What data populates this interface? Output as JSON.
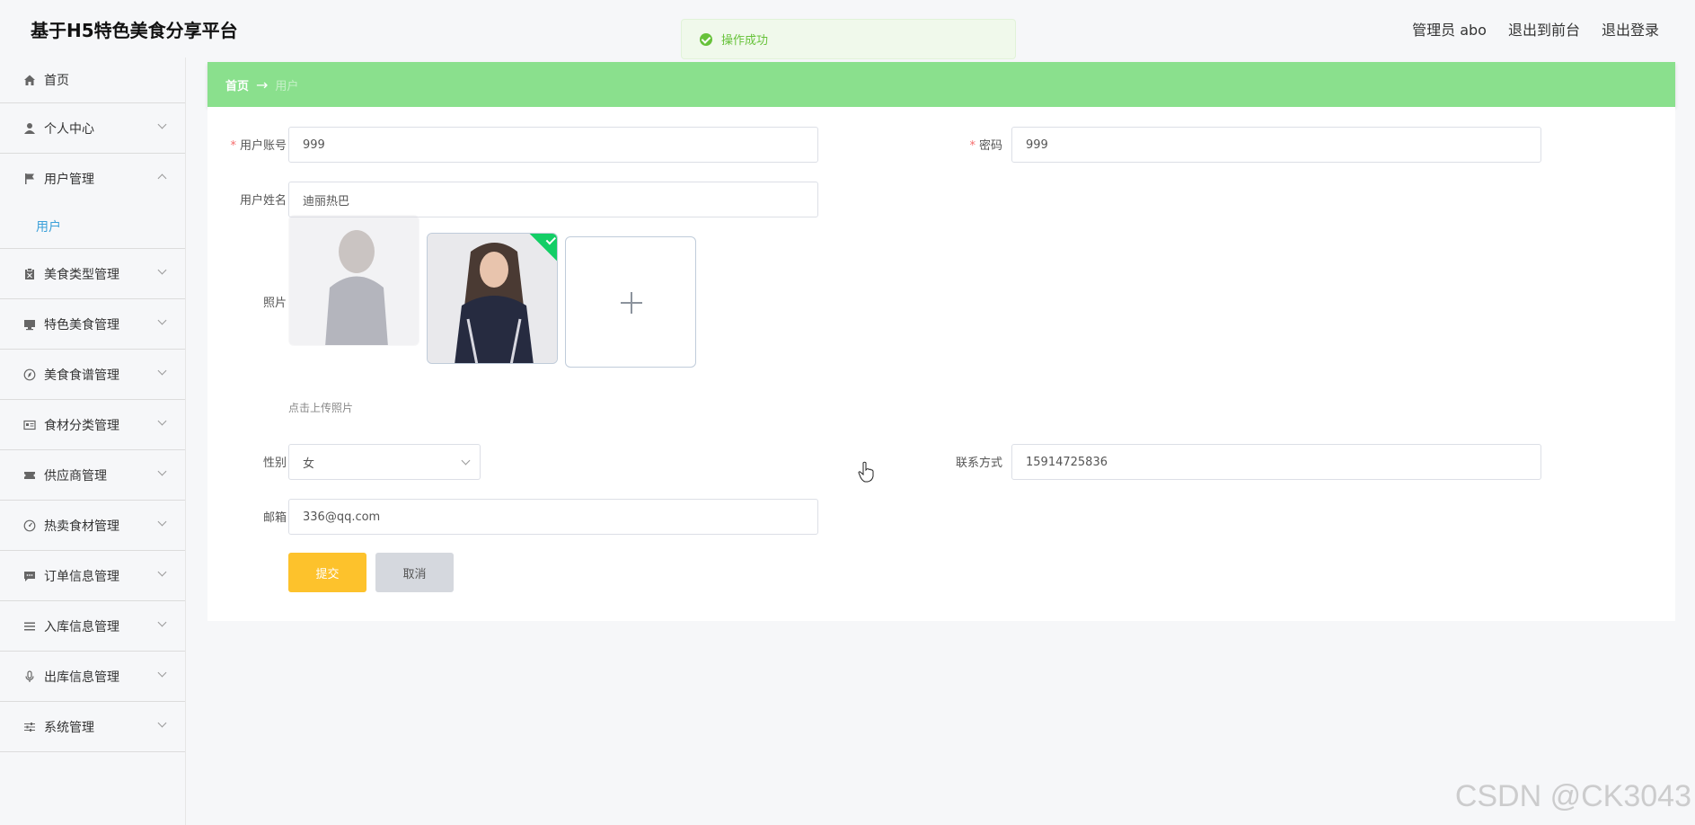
{
  "header": {
    "title": "基于H5特色美食分享平台",
    "user": "管理员 abo",
    "to_front": "退出到前台",
    "logout": "退出登录"
  },
  "toast": {
    "text": "操作成功",
    "color": "#67c23a"
  },
  "sidebar": {
    "items": [
      {
        "label": "首页",
        "icon": "home-icon"
      },
      {
        "label": "个人中心",
        "icon": "user-icon"
      },
      {
        "label": "用户管理",
        "icon": "flag-icon",
        "expanded": true,
        "children": [
          "用户"
        ]
      },
      {
        "label": "美食类型管理",
        "icon": "clipboard-icon"
      },
      {
        "label": "特色美食管理",
        "icon": "monitor-icon"
      },
      {
        "label": "美食食谱管理",
        "icon": "compass-icon"
      },
      {
        "label": "食材分类管理",
        "icon": "id-card-icon"
      },
      {
        "label": "供应商管理",
        "icon": "ticket-icon"
      },
      {
        "label": "热卖食材管理",
        "icon": "dashboard-icon"
      },
      {
        "label": "订单信息管理",
        "icon": "chat-icon"
      },
      {
        "label": "入库信息管理",
        "icon": "list-icon"
      },
      {
        "label": "出库信息管理",
        "icon": "microphone-icon"
      },
      {
        "label": "系统管理",
        "icon": "sliders-icon"
      }
    ]
  },
  "breadcrumb": {
    "home": "首页",
    "arrow": "→",
    "current": "用户"
  },
  "form": {
    "account": {
      "label": "用户账号",
      "value": "999",
      "required": true
    },
    "password": {
      "label": "密码",
      "value": "999",
      "required": true
    },
    "name": {
      "label": "用户姓名",
      "value": "迪丽热巴"
    },
    "photo": {
      "label": "照片",
      "hint": "点击上传照片"
    },
    "gender": {
      "label": "性别",
      "value": "女"
    },
    "phone": {
      "label": "联系方式",
      "value": "15914725836"
    },
    "email": {
      "label": "邮箱",
      "value": "336@qq.com"
    },
    "submit": "提交",
    "cancel": "取消"
  },
  "colors": {
    "accent_green": "#8ae08d",
    "submit": "#fdc22c",
    "link": "#3ba0d9"
  },
  "watermark": "CSDN @CK3043"
}
